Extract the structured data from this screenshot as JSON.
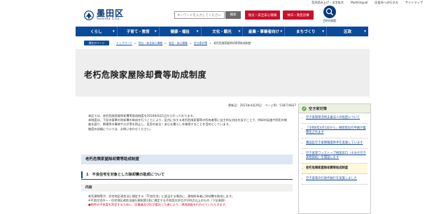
{
  "topstrip": {
    "items": [
      "音声読み上げ・文字拡大",
      "Multilingual",
      "区役所への行き方",
      "サイトマップ"
    ]
  },
  "header": {
    "logo_ja": "墨田区",
    "logo_en": "Sumida City",
    "search_placeholder": "キーワードを入力してください",
    "search_button": "検索",
    "safety_button": "防災・安全安心情報",
    "emergency_button": "休日・救急診療",
    "find_label": "目的別検索"
  },
  "nav": {
    "items": [
      "くらし",
      "子育て・教育",
      "健康・福祉",
      "文化・観光",
      "産業・事業者向け",
      "まちづくり",
      "区政"
    ]
  },
  "breadcrumb": {
    "current_label": "現在のページ",
    "items": [
      "トップページ",
      "防災・安全安心情報",
      "安全・安心情報",
      "空き家対策",
      "老朽危険家屋除却費等助成制度"
    ]
  },
  "page": {
    "title": "老朽危険家屋除却費等助成制度",
    "meta": "更新日：2023年4月29日　ページID：538710837",
    "intro": [
      "本区では、老朽危険家屋除却費等助成制度を2016年6月1日から行っております。",
      "本制度は、下記の基準の除却費の助成を行うことにより、区内に存する老朽危険家屋等の所有者等に自主的な対応を促すことで、除却の促進や防犯の推進を図り、倒壊等の事故や火災等を防止し、区民の安全・安心な暮らしを確保することを目的としています。",
      "制度の詳細については、お問い合わせください。"
    ],
    "h2": "老朽危険家屋除却費等助成制度",
    "h3_num": "1",
    "h3": "不良住宅を対象とした除却費の助成について",
    "h4": "内容",
    "body": [
      "老朽建物等が、住宅地区改良法に規定する「不良住宅」に該当する場合に、建物所有者に除却費を助成します。",
      "※不良住宅の一・住宅地区改良法施行規則第1条に規定する不良度の評点が100点以上のもの（下記参照）"
    ],
    "body_red": "●物件の不良度を判定するために、区職員及び区が委託した者により、現地調査を行わせていただきます。"
  },
  "sidebar": {
    "title": "空き家対策",
    "items": [
      "空き家管理活用支援法人の指定について",
      "「令和6年4月1日から」相続登記の申請が義務化されます",
      "墨田区空き家情報提供手を実施しています",
      "空き家等ワンストップ相談窓口（すみだ空き家相談処）を開設します",
      "老朽危険家屋除却費等助成制度",
      "空き家等の行政代執行を実施しました"
    ],
    "current_index": 4
  },
  "colors": {
    "brand": "#0a3a7a",
    "nav": "#0a4a9a",
    "alert": "#c8102e"
  }
}
